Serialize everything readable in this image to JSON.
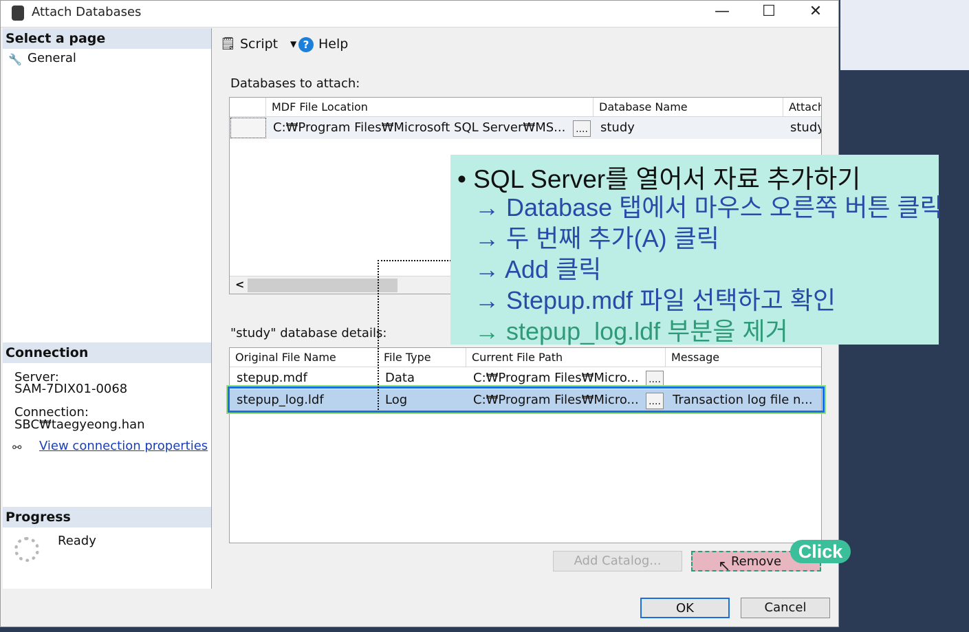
{
  "window": {
    "title": "Attach Databases",
    "minimize": "—",
    "maximize": "☐",
    "close": "✕"
  },
  "left_panel": {
    "select_page_header": "Select a page",
    "pages": [
      {
        "label": "General",
        "icon": "wrench-icon"
      }
    ],
    "connection_header": "Connection",
    "server_label": "Server:",
    "server_value": "SAM-7DIX01-0068",
    "connection_label": "Connection:",
    "connection_value": "SBC₩taegyeong.han",
    "view_connection_link": "View connection properties",
    "progress_header": "Progress",
    "progress_status": "Ready"
  },
  "toolbar": {
    "script_label": "Script",
    "help_label": "Help"
  },
  "attach_grid": {
    "section_label": "Databases to attach:",
    "columns": [
      "MDF File Location",
      "Database Name",
      "Attach"
    ],
    "rows": [
      {
        "mdf_location": "C:₩Program Files₩Microsoft SQL Server₩MS...",
        "ellipsis": "....",
        "database_name": "study",
        "attach_as": "study"
      }
    ],
    "scroll_left": "<"
  },
  "details_grid": {
    "section_label": "\"study\" database details:",
    "columns": [
      "Original File Name",
      "File Type",
      "Current File Path",
      "Message"
    ],
    "rows": [
      {
        "file_name": "stepup.mdf",
        "file_type": "Data",
        "path": "C:₩Program Files₩Micro...",
        "ellipsis": "....",
        "message": ""
      },
      {
        "file_name": "stepup_log.ldf",
        "file_type": "Log",
        "path": "C:₩Program Files₩Micro...",
        "ellipsis": "....",
        "message": "Transaction log file n..."
      }
    ]
  },
  "buttons": {
    "add_catalog": "Add Catalog...",
    "remove": "Remove",
    "ok": "OK",
    "cancel": "Cancel"
  },
  "overlay": {
    "title": "• SQL Server를 열어서 자료 추가하기",
    "steps": [
      "→ Database 탭에서 마우스 오른쪽 버튼 클릭",
      "→ 두 번째 추가(A) 클릭",
      "→ Add 클릭",
      "→ Stepup.mdf 파일 선택하고 확인",
      "→ stepup_log.ldf 부분을 제거"
    ],
    "click_badge": "Click"
  },
  "colors": {
    "highlight_row": "#b9d3ee",
    "selection_border": "#1a6fe0",
    "overlay_bg": "#bdeee6",
    "overlay_text": "#2a4aa8",
    "overlay_last": "#2e9a78",
    "remove_fill": "#e8b6c0"
  }
}
